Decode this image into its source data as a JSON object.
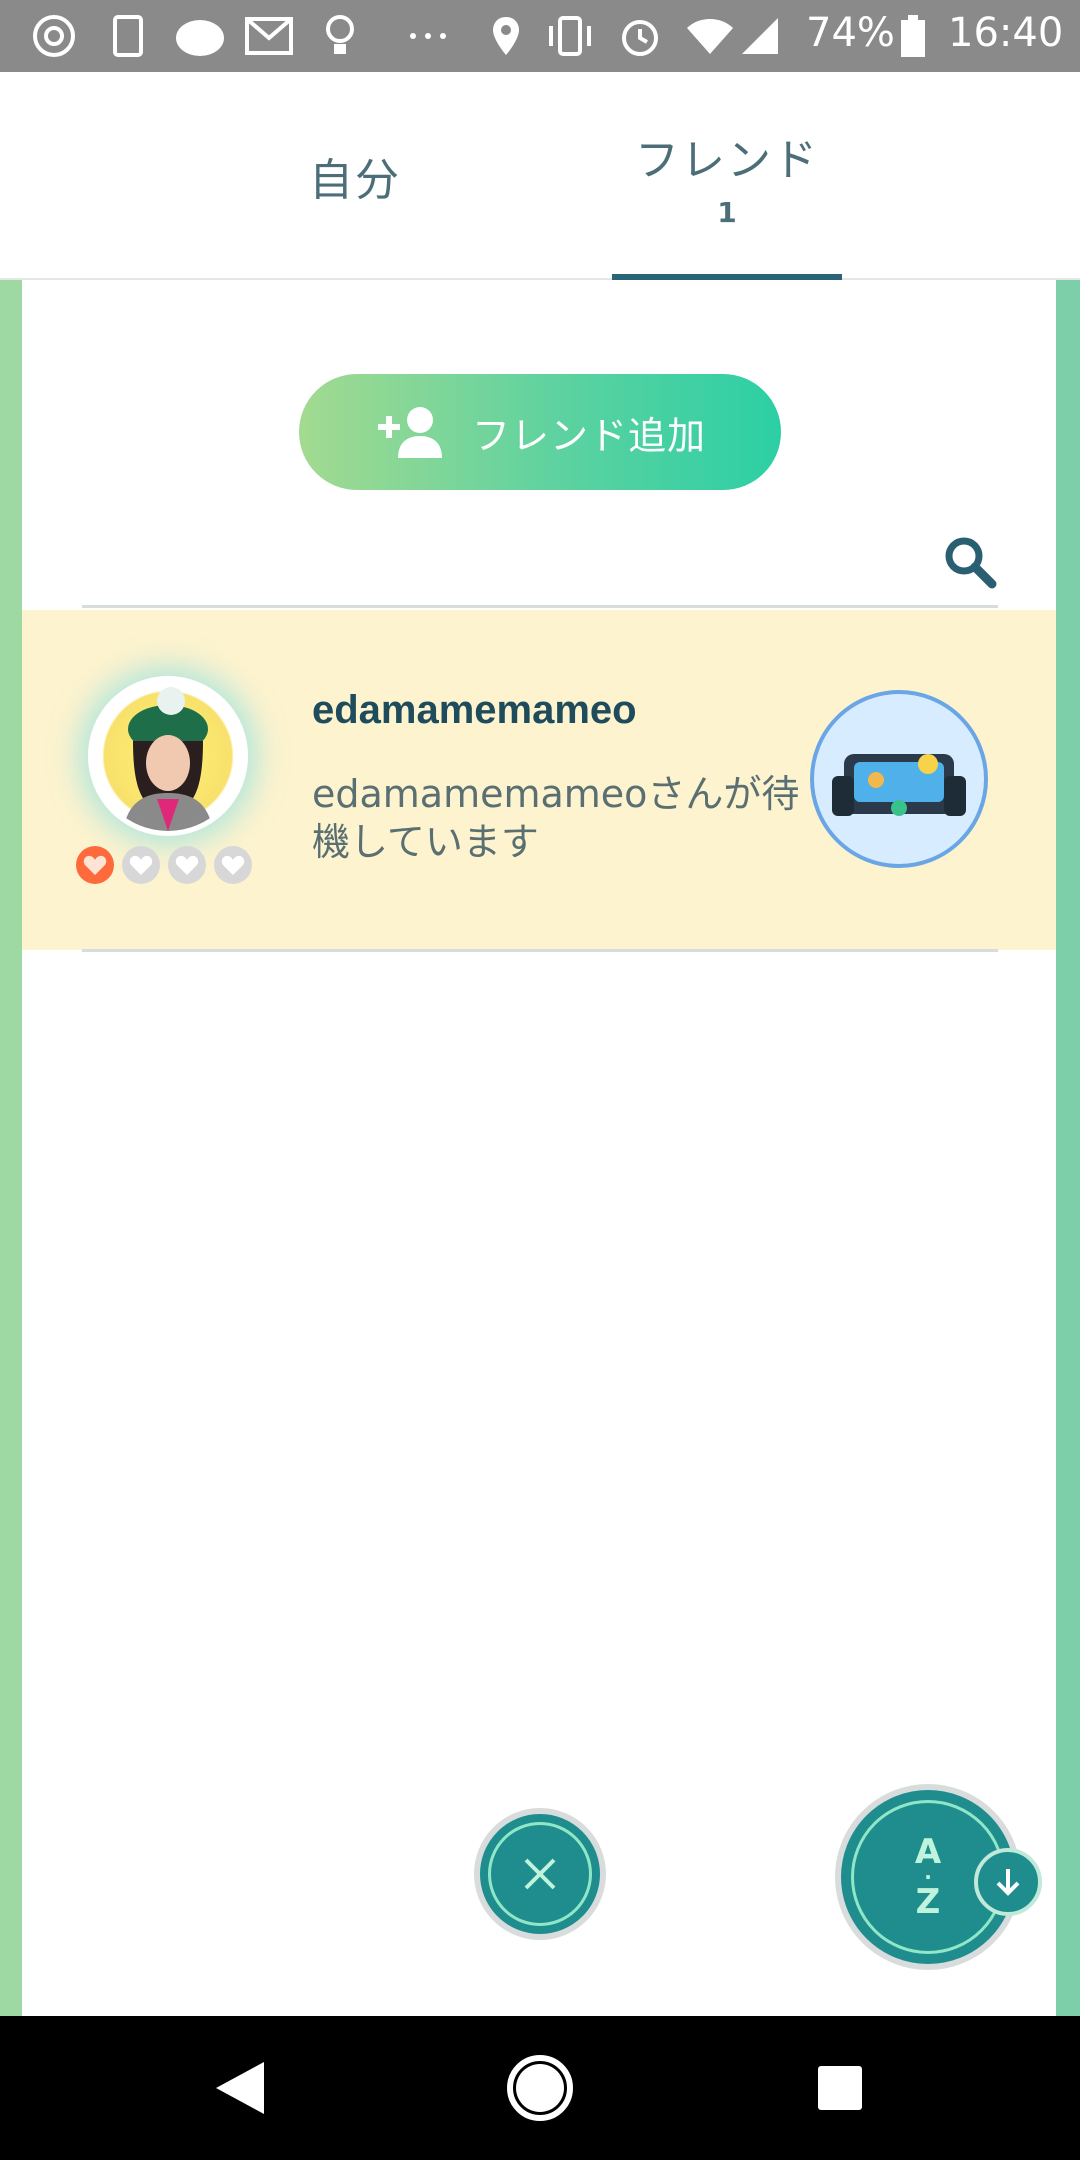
{
  "status_bar": {
    "battery_percent": "74%",
    "time": "16:40",
    "icons": [
      "chrome-icon",
      "app-icon",
      "app-badge-icon",
      "gmail-icon",
      "lightbulb-icon",
      "more-notifications-icon",
      "location-icon",
      "vibrate-icon",
      "alarm-icon",
      "wifi-icon",
      "signal-icon",
      "battery-icon"
    ]
  },
  "tabs": [
    {
      "label": "自分",
      "count": ""
    },
    {
      "label": "フレンド",
      "count": "1"
    }
  ],
  "add_friend_label": "フレンド追加",
  "friends": [
    {
      "name": "edamamemameo",
      "status": "edamamemameoさんが待機しています",
      "hearts_filled": 1,
      "hearts_total": 4
    }
  ],
  "sort_button": {
    "top": "A",
    "bottom": "Z"
  },
  "colors": {
    "accent_teal": "#1f8d8d",
    "tab_underline": "#2a6478",
    "row_highlight": "#fdf3cf",
    "button_gradient_start": "#a3da90",
    "button_gradient_end": "#2ccfa5"
  }
}
